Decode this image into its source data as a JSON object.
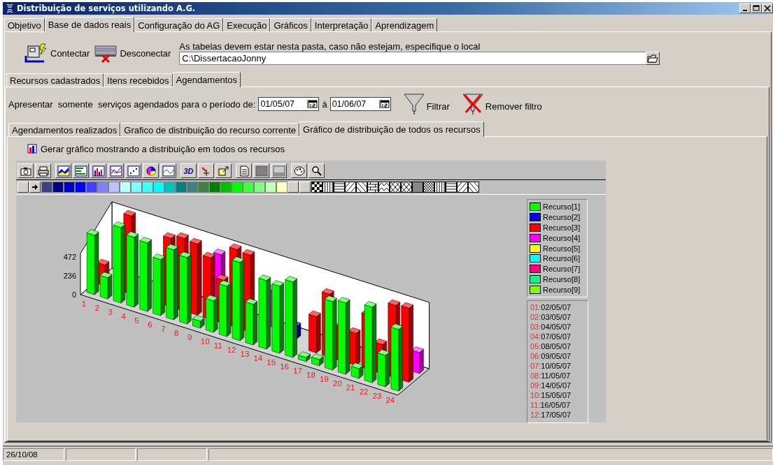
{
  "window": {
    "title": "Distribuição de serviços utilizando A.G."
  },
  "main_tabs": [
    {
      "label": "Objetivo",
      "selected": false
    },
    {
      "label": "Base de dados reais",
      "selected": true
    },
    {
      "label": "Configuração do AG",
      "selected": false
    },
    {
      "label": "Execução",
      "selected": false
    },
    {
      "label": "Gráficos",
      "selected": false
    },
    {
      "label": "Interpretação",
      "selected": false
    },
    {
      "label": "Aprendizagem",
      "selected": false
    }
  ],
  "connection": {
    "connect_label": "Contectar",
    "disconnect_label": "Desconectar",
    "folder_hint": "As tabelas devem estar nesta pasta, caso não estejam, especifique o local",
    "folder_path": "C:\\DissertacaoJonny"
  },
  "sub_tabs": [
    {
      "label": "Recursos cadastrados",
      "selected": false
    },
    {
      "label": "Itens recebidos",
      "selected": false
    },
    {
      "label": "Agendamentos",
      "selected": true
    }
  ],
  "period_filter": {
    "label": "Apresentar  somente  serviços agendados para o período de:",
    "start_date": "01/05/07",
    "separator": "à",
    "end_date": "01/06/07",
    "filter_button": "Filtrar",
    "remove_filter_button": "Remover filtro"
  },
  "chart_tabs": [
    {
      "label": "Agendamentos realizados",
      "selected": false
    },
    {
      "label": "Grafico de distribuição do recurso corrente",
      "selected": false
    },
    {
      "label": "Gráfico de distribuição de todos os recursos",
      "selected": true
    }
  ],
  "generate_button": "Gerar gráfico mostrando a distribuição em todos os recursos",
  "chart": {
    "toolbar_3d_label": "3D",
    "palette": [
      {
        "color": "#404080"
      },
      {
        "color": "#000080"
      },
      {
        "color": "#0000c0"
      },
      {
        "color": "#0000ff"
      },
      {
        "color": "#4040ff"
      },
      {
        "color": "#8080ff"
      },
      {
        "color": "#c0c0ff"
      },
      {
        "color": "#c0ffff"
      },
      {
        "color": "#80ffff"
      },
      {
        "color": "#40ffff"
      },
      {
        "color": "#00ffff"
      },
      {
        "color": "#00c0c0"
      },
      {
        "color": "#008080"
      },
      {
        "color": "#408080"
      },
      {
        "color": "#408040"
      },
      {
        "color": "#008000"
      },
      {
        "color": "#00c000"
      },
      {
        "color": "#00ff00"
      },
      {
        "color": "#40ff40"
      },
      {
        "color": "#80ff80"
      },
      {
        "color": "#c0ffc0"
      },
      {
        "color": "#ffffc0"
      }
    ],
    "y_ticks": [
      "472",
      "236",
      "0"
    ],
    "x_labels": [
      "1",
      "2",
      "3",
      "4",
      "5",
      "6",
      "7",
      "8",
      "9",
      "10",
      "11",
      "12",
      "13",
      "14",
      "15",
      "16",
      "17",
      "18",
      "19",
      "20",
      "21",
      "22",
      "23",
      "24"
    ],
    "legend": [
      {
        "label": "Recurso[1]",
        "color": "#00ff00"
      },
      {
        "label": "Recurso[2]",
        "color": "#0000ff"
      },
      {
        "label": "Recurso[3]",
        "color": "#ff0000"
      },
      {
        "label": "Recurso[4]",
        "color": "#ff00ff"
      },
      {
        "label": "Recurso[5]",
        "color": "#ffff00"
      },
      {
        "label": "Recurso[6]",
        "color": "#00ffff"
      },
      {
        "label": "Recurso[7]",
        "color": "#ff0080"
      },
      {
        "label": "Recurso[8]",
        "color": "#00ff80"
      },
      {
        "label": "Recurso[9]",
        "color": "#80ff00"
      }
    ],
    "date_list": [
      {
        "index": "01:",
        "date": "02/05/07"
      },
      {
        "index": "02:",
        "date": "03/05/07"
      },
      {
        "index": "03:",
        "date": "04/05/07"
      },
      {
        "index": "04:",
        "date": "07/05/07"
      },
      {
        "index": "05:",
        "date": "08/05/07"
      },
      {
        "index": "06:",
        "date": "09/05/07"
      },
      {
        "index": "07:",
        "date": "10/05/07"
      },
      {
        "index": "08:",
        "date": "11/05/07"
      },
      {
        "index": "09:",
        "date": "14/05/07"
      },
      {
        "index": "10:",
        "date": "15/05/07"
      },
      {
        "index": "11:",
        "date": "16/05/07"
      },
      {
        "index": "12:",
        "date": "17/05/07"
      }
    ]
  },
  "status_bar": {
    "panels": [
      "26/10/08"
    ]
  }
}
